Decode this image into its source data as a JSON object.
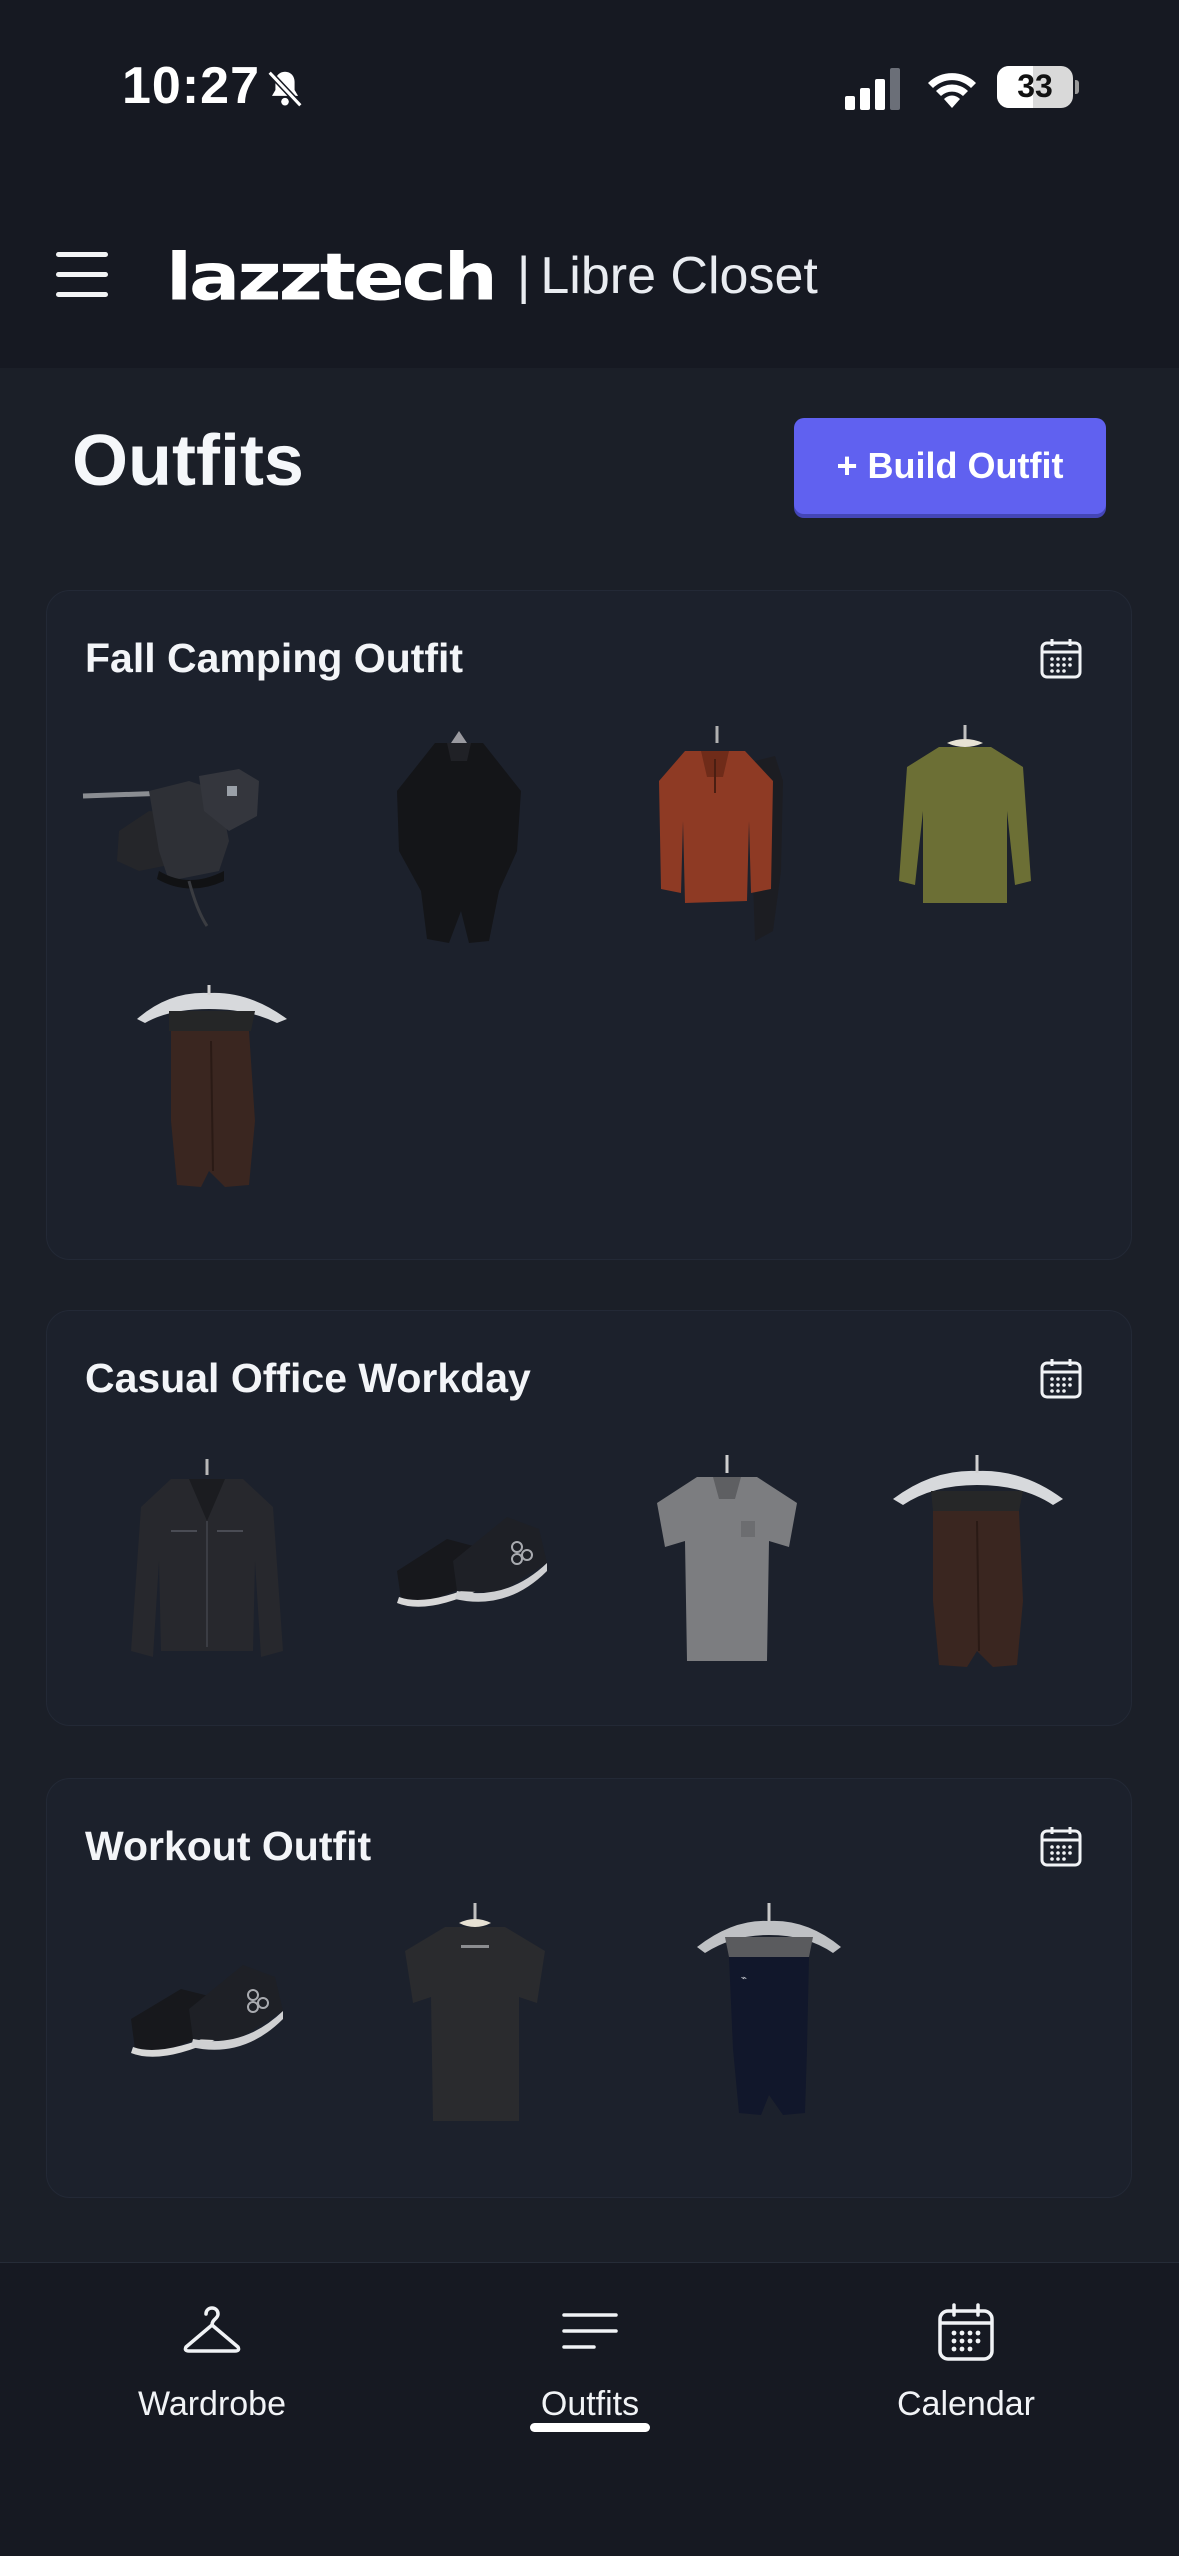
{
  "status_bar": {
    "time": "10:27",
    "battery": "33",
    "icons": [
      "bell-slash-icon",
      "cellular-signal-icon",
      "wifi-icon",
      "battery-icon"
    ]
  },
  "header": {
    "menu_icon": "hamburger-menu-icon",
    "logo_text": "lazztech",
    "separator": "|",
    "app_name": "Libre Closet"
  },
  "page": {
    "title": "Outfits",
    "build_button": "+ Build Outfit",
    "accent_color": "#6061f0"
  },
  "outfits": [
    {
      "name": "Fall Camping Outfit",
      "calendar_icon": "calendar-icon",
      "items": [
        "black hiking boots",
        "black poncho",
        "rust orange fleece half-zip with black rain shell",
        "olive green long sleeve shirt",
        "brown pants on hanger"
      ]
    },
    {
      "name": "Casual Office Workday",
      "calendar_icon": "calendar-icon",
      "items": [
        "black leather jacket",
        "black sneakers",
        "grey polo shirt",
        "brown pants on hanger"
      ]
    },
    {
      "name": "Workout Outfit",
      "calendar_icon": "calendar-icon",
      "items": [
        "black sneakers",
        "black t-shirt",
        "navy athletic pants on hanger"
      ]
    }
  ],
  "bottom_nav": {
    "items": [
      {
        "label": "Wardrobe",
        "icon": "hanger-icon"
      },
      {
        "label": "Outfits",
        "icon": "list-lines-icon",
        "active": true
      },
      {
        "label": "Calendar",
        "icon": "calendar-icon"
      }
    ]
  }
}
